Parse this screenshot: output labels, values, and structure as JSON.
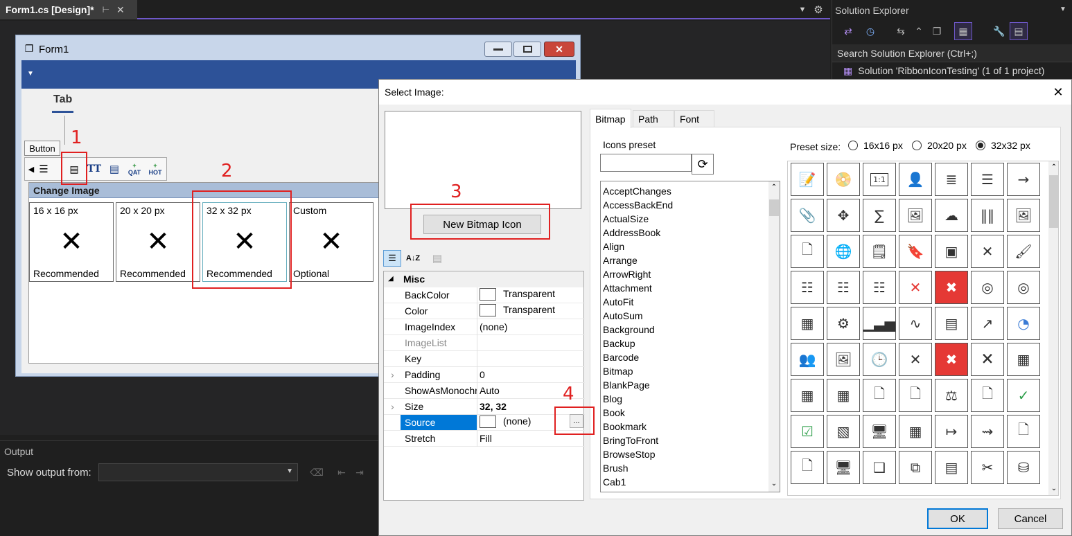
{
  "shell": {
    "doc_tab_label": "Form1.cs [Design]*",
    "solution_explorer_title": "Solution Explorer",
    "solution_search_placeholder": "Search Solution Explorer (Ctrl+;)",
    "solution_node": "Solution 'RibbonIconTesting' (1 of 1 project)",
    "output_title": "Output",
    "output_show_from_label": "Show output from:",
    "output_source_value": ""
  },
  "form": {
    "title": "Form1",
    "ribbon_tab": "Tab",
    "button_label": "Button",
    "toolbar_qat": "QAT",
    "toolbar_hot": "HOT",
    "change_image_header": "Change Image",
    "gallery": [
      {
        "size": "16 x 16 px",
        "glyph": "✕",
        "note": "Recommended"
      },
      {
        "size": "20 x 20 px",
        "glyph": "✕",
        "note": "Recommended"
      },
      {
        "size": "32 x 32 px",
        "glyph": "✕",
        "note": "Recommended"
      },
      {
        "size": "Custom",
        "glyph": "✕",
        "note": "Optional"
      }
    ]
  },
  "annotations": [
    "1",
    "2",
    "3",
    "4"
  ],
  "dialog": {
    "title": "Select Image:",
    "new_bitmap_button": "New Bitmap Icon",
    "property_category": "Misc",
    "properties": [
      {
        "name": "BackColor",
        "value": "Transparent",
        "swatch": true,
        "expand": false
      },
      {
        "name": "Color",
        "value": "Transparent",
        "swatch": true,
        "expand": false
      },
      {
        "name": "ImageIndex",
        "value": "(none)",
        "swatch": false,
        "expand": false
      },
      {
        "name": "ImageList",
        "value": "",
        "swatch": false,
        "expand": false
      },
      {
        "name": "Key",
        "value": "",
        "swatch": false,
        "expand": false
      },
      {
        "name": "Padding",
        "value": "0",
        "swatch": false,
        "expand": true
      },
      {
        "name": "ShowAsMonochrome",
        "value": "Auto",
        "swatch": false,
        "expand": false
      },
      {
        "name": "Size",
        "value": "32, 32",
        "swatch": false,
        "expand": true
      },
      {
        "name": "Source",
        "value": "(none)",
        "swatch": true,
        "expand": false
      },
      {
        "name": "Stretch",
        "value": "Fill",
        "swatch": false,
        "expand": false
      }
    ],
    "source_ellipsis": "...",
    "tabs": [
      "Bitmap",
      "Path",
      "Font"
    ],
    "icons_preset_label": "Icons preset",
    "preset_size_label": "Preset size:",
    "preset_sizes": [
      "16x16 px",
      "20x20 px",
      "32x32 px"
    ],
    "preset_selected": "32x32 px",
    "icon_names": [
      "AcceptChanges",
      "AccessBackEnd",
      "ActualSize",
      "AddressBook",
      "Align",
      "Arrange",
      "ArrowRight",
      "Attachment",
      "AutoFit",
      "AutoSum",
      "Background",
      "Backup",
      "Barcode",
      "Bitmap",
      "BlankPage",
      "Blog",
      "Book",
      "Bookmark",
      "BringToFront",
      "BrowseStop",
      "Brush",
      "Cab1"
    ],
    "ok_button": "OK",
    "cancel_button": "Cancel",
    "icon_grid_glyphs": [
      "📝",
      "📀",
      "1:1",
      "👤",
      "≣",
      "☰",
      "→",
      "📎",
      "✥",
      "∑",
      "🖼",
      "☁",
      "‖‖",
      "🖼",
      "🗋",
      "🌐",
      "🗒",
      "🔖",
      "▣",
      "✕",
      "🖌",
      "☷",
      "☷",
      "☷",
      "✕",
      "✖",
      "◎",
      "◎",
      "▦",
      "⚙",
      "▁▃▅",
      "∿",
      "▤",
      "↗",
      "◔",
      "👥",
      "🖼",
      "🕒",
      "✕",
      "✖",
      "🗙",
      "▦",
      "▦",
      "▦",
      "🗋",
      "🗋",
      "⚖",
      "🗋",
      "✓",
      "☑",
      "▧",
      "🖥",
      "▦",
      "↦",
      "⇝",
      "🗋",
      "🗋",
      "🖥",
      "❑",
      "⧉",
      "▤",
      "✂",
      "⛁"
    ]
  },
  "colors": {
    "accent_red": "#e02020",
    "ribbon_blue": "#2d5298",
    "selection_blue": "#0078d7",
    "vs_purple": "#6e58c8"
  }
}
